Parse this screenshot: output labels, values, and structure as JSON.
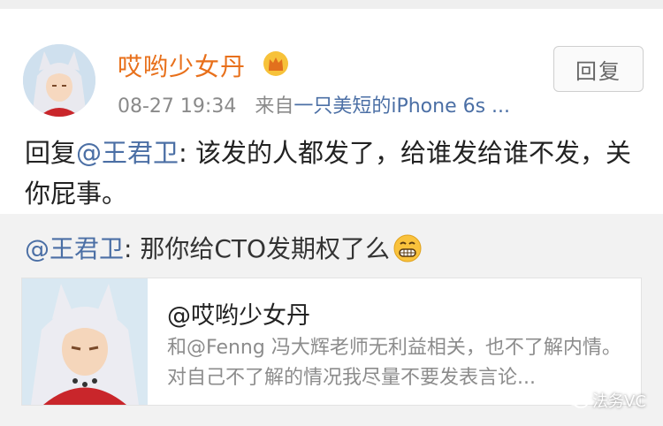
{
  "post": {
    "username": "哎哟少女丹",
    "time": "08-27 19:34",
    "from_label": "来自",
    "source": "一只美短的iPhone 6s ...",
    "reply_button": "回复",
    "body_prefix": "回复",
    "body_mention": "@王君卫",
    "body_text": ": 该发的人都发了，给谁发给谁不发，关你屁事。"
  },
  "quote": {
    "mention": "@王君卫",
    "text": ": 那你给CTO发期权了么"
  },
  "card": {
    "title": "@哎哟少女丹",
    "description": "和@Fenng 冯大辉老师无利益相关，也不了解内情。对自己不了解的情况我尽量不要发表言论..."
  },
  "watermark": {
    "text": "法务VC"
  },
  "colors": {
    "username": "#e8701b",
    "link": "#4b6fa5",
    "background": "#f2f2f2",
    "card_bg": "#ffffff"
  },
  "icons": {
    "vip": "crown-badge-icon",
    "emoji": "grin-emoji-icon",
    "watermark": "wechat-icon"
  }
}
